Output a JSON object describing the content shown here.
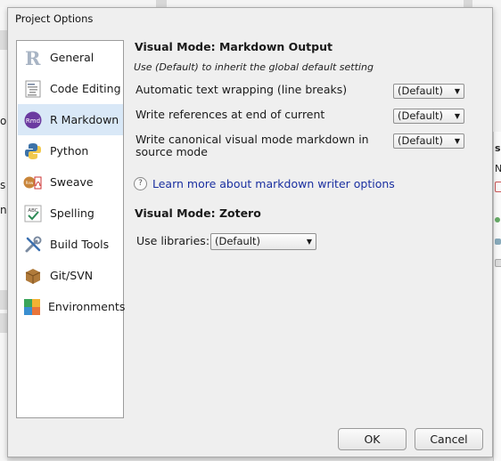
{
  "window": {
    "title": "Project Options"
  },
  "sidebar": {
    "items": [
      {
        "label": "General",
        "icon": "r-logo-icon"
      },
      {
        "label": "Code Editing",
        "icon": "code-document-icon"
      },
      {
        "label": "R Markdown",
        "icon": "rmd-icon",
        "selected": true
      },
      {
        "label": "Python",
        "icon": "python-icon"
      },
      {
        "label": "Sweave",
        "icon": "sweave-icon"
      },
      {
        "label": "Spelling",
        "icon": "spellcheck-icon"
      },
      {
        "label": "Build Tools",
        "icon": "build-tools-icon"
      },
      {
        "label": "Git/SVN",
        "icon": "git-box-icon"
      },
      {
        "label": "Environments",
        "icon": "environments-icon"
      }
    ]
  },
  "main": {
    "section1_title": "Visual Mode: Markdown Output",
    "hint": "Use (Default) to inherit the global default setting",
    "options": [
      {
        "label": "Automatic text wrapping (line breaks)",
        "value": "(Default)"
      },
      {
        "label": "Write references at end of current",
        "value": "(Default)"
      },
      {
        "label": "Write canonical visual mode markdown in source mode",
        "value": "(Default)"
      }
    ],
    "learn_more": "Learn more about markdown writer options",
    "section2_title": "Visual Mode: Zotero",
    "libraries_label": "Use libraries:",
    "libraries_value": "(Default)"
  },
  "buttons": {
    "ok": "OK",
    "cancel": "Cancel"
  },
  "background": {
    "left_fragments": [
      "o",
      "s",
      "n"
    ],
    "right_fragments": [
      "s",
      "Ne"
    ]
  },
  "colors": {
    "selected": "#d9e8f7",
    "link": "#1a2fa0",
    "rmd": "#6b3aa0"
  }
}
